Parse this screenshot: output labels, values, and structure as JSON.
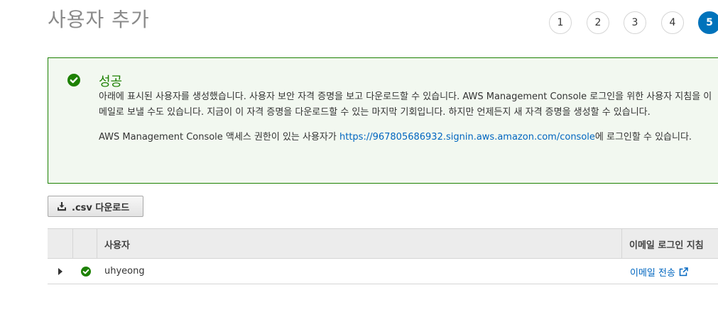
{
  "page": {
    "title": "사용자 추가"
  },
  "steps": [
    "1",
    "2",
    "3",
    "4",
    "5"
  ],
  "current_step": "5",
  "alert": {
    "title": "성공",
    "message": "아래에 표시된 사용자를 생성했습니다. 사용자 보안 자격 증명을 보고 다운로드할 수 있습니다. AWS Management Console 로그인을 위한 사용자 지침을 이메일로 보낼 수도 있습니다. 지금이 이 자격 증명을 다운로드할 수 있는 마지막 기회입니다. 하지만 언제든지 새 자격 증명을 생성할 수 있습니다.",
    "console_prefix": "AWS Management Console 액세스 권한이 있는 사용자가 ",
    "console_link": "https://967805686932.signin.aws.amazon.com/console",
    "console_suffix": "에 로그인할 수 있습니다."
  },
  "toolbar": {
    "csv_label": ".csv 다운로드"
  },
  "table": {
    "headers": {
      "user": "사용자",
      "email_instructions": "이메일 로그인 지침"
    },
    "rows": [
      {
        "username": "uhyeong",
        "email_action": "이메일 전송"
      }
    ]
  },
  "colors": {
    "accent": "#0073bb",
    "success": "#1d8102",
    "link": "#0066c0"
  },
  "icons": {
    "alert": "check-circle-icon",
    "csv": "download-icon",
    "row_status": "check-circle-icon",
    "external": "external-link-icon"
  }
}
